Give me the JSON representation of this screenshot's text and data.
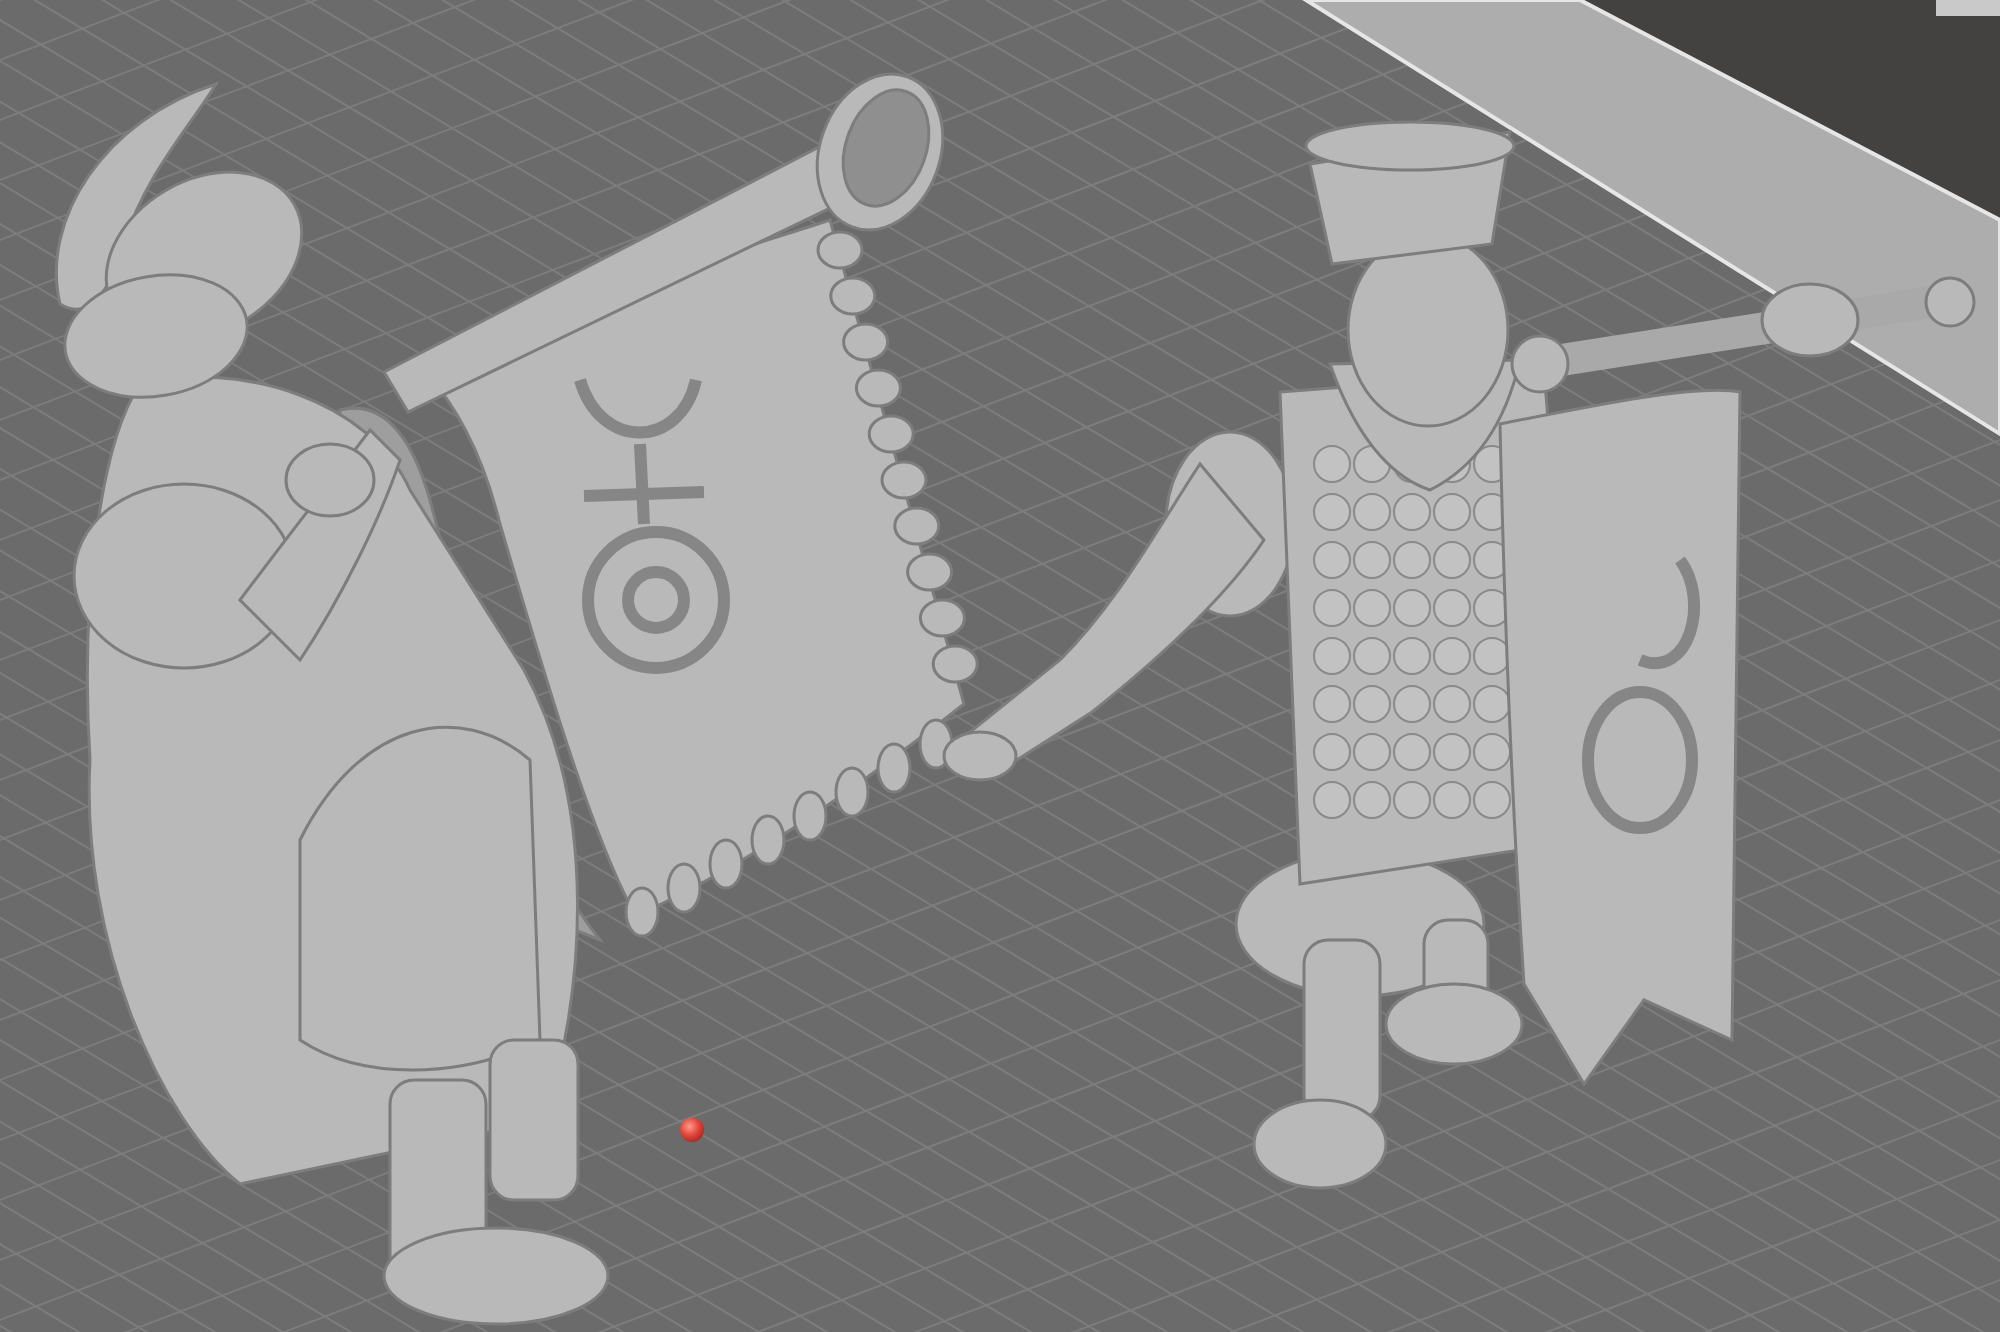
{
  "viewport": {
    "models": [
      {
        "kind": "trumpeter"
      },
      {
        "kind": "banner_bearer"
      }
    ]
  }
}
